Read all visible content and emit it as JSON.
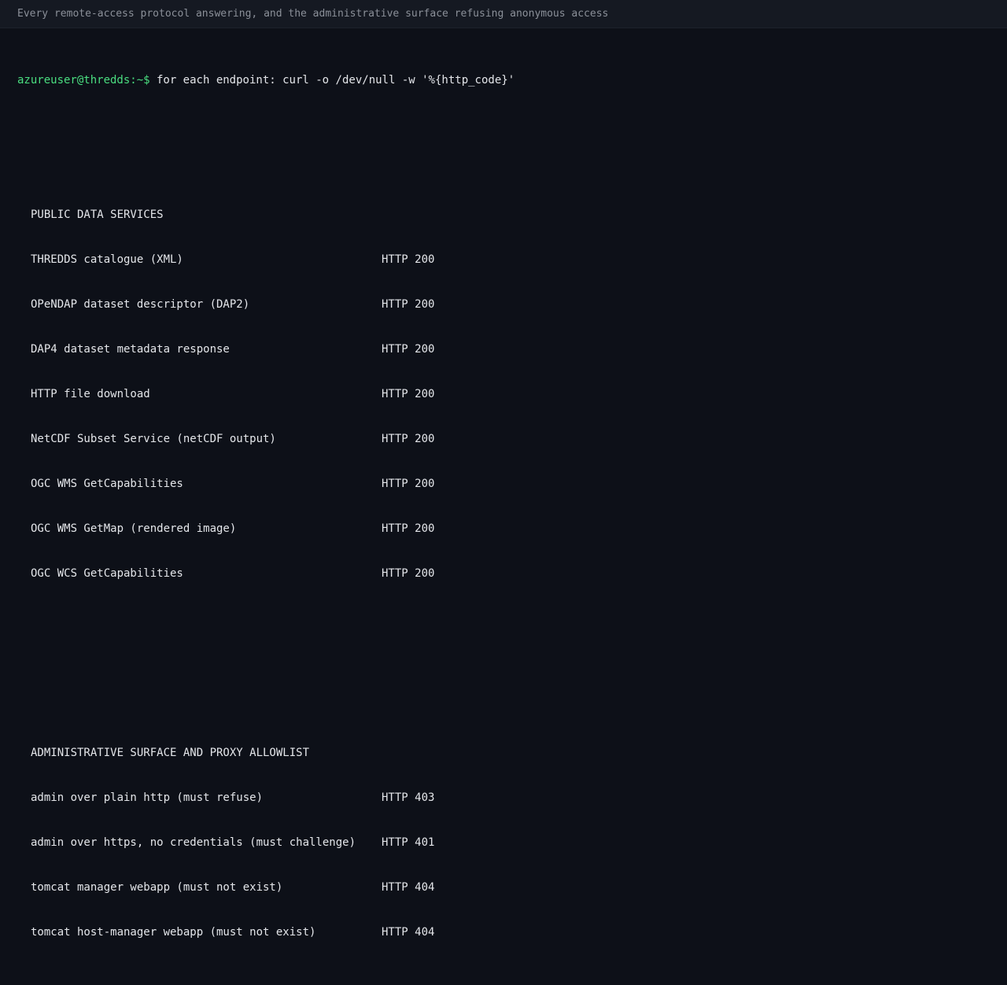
{
  "caption": "Every remote-access protocol answering, and the administrative surface refusing anonymous access",
  "terminal": {
    "prompt": "azureuser@thredds:~$",
    "command": "for each endpoint: curl -o /dev/null -w '%{http_code}'",
    "sections": [
      {
        "heading": "PUBLIC DATA SERVICES",
        "rows": [
          {
            "label": "THREDDS catalogue (XML)",
            "status": "HTTP 200"
          },
          {
            "label": "OPeNDAP dataset descriptor (DAP2)",
            "status": "HTTP 200"
          },
          {
            "label": "DAP4 dataset metadata response",
            "status": "HTTP 200"
          },
          {
            "label": "HTTP file download",
            "status": "HTTP 200"
          },
          {
            "label": "NetCDF Subset Service (netCDF output)",
            "status": "HTTP 200"
          },
          {
            "label": "OGC WMS GetCapabilities",
            "status": "HTTP 200"
          },
          {
            "label": "OGC WMS GetMap (rendered image)",
            "status": "HTTP 200"
          },
          {
            "label": "OGC WCS GetCapabilities",
            "status": "HTTP 200"
          }
        ]
      },
      {
        "heading": "ADMINISTRATIVE SURFACE AND PROXY ALLOWLIST",
        "rows": [
          {
            "label": "admin over plain http (must refuse)",
            "status": "HTTP 403"
          },
          {
            "label": "admin over https, no credentials (must challenge)",
            "status": "HTTP 401"
          },
          {
            "label": "tomcat manager webapp (must not exist)",
            "status": "HTTP 404"
          },
          {
            "label": "tomcat host-manager webapp (must not exist)",
            "status": "HTTP 404"
          }
        ]
      }
    ]
  },
  "colors": {
    "background": "#0d1018",
    "caption_bar": "#151922",
    "prompt": "#4ade80",
    "text": "#e4e6ea",
    "caption_text": "#8b9099"
  }
}
